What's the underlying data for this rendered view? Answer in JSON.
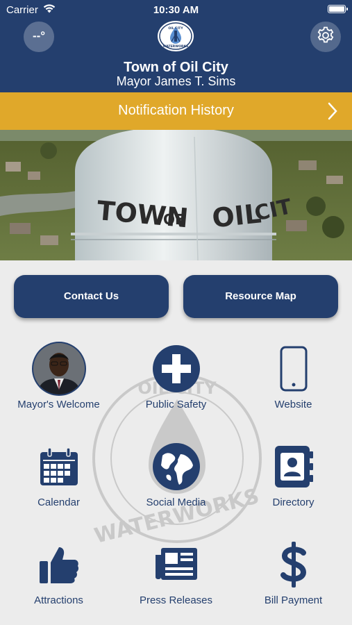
{
  "status_bar": {
    "carrier": "Carrier",
    "time": "10:30 AM"
  },
  "header": {
    "weather": "--°",
    "title": "Town of Oil City",
    "subtitle": "Mayor James T. Sims",
    "logo_text": {
      "top": "OIL CITY",
      "bottom": "WATERWORKS"
    }
  },
  "notification_bar": {
    "label": "Notification History"
  },
  "hero": {
    "tank_text": {
      "town": "TOWN",
      "of": "OF",
      "oil": "OIL",
      "city": "CIT"
    }
  },
  "buttons": {
    "contact": "Contact Us",
    "resource_map": "Resource Map"
  },
  "watermark": {
    "top": "OIL CITY",
    "bottom": "WATERWORKS"
  },
  "grid": [
    {
      "label": "Mayor's Welcome",
      "icon": "mayor-photo"
    },
    {
      "label": "Public Safety",
      "icon": "cross-icon"
    },
    {
      "label": "Website",
      "icon": "phone-icon"
    },
    {
      "label": "Calendar",
      "icon": "calendar-icon"
    },
    {
      "label": "Social Media",
      "icon": "globe-icon"
    },
    {
      "label": "Directory",
      "icon": "address-book-icon"
    },
    {
      "label": "Attractions",
      "icon": "thumbs-up-icon"
    },
    {
      "label": "Press Releases",
      "icon": "newspaper-icon"
    },
    {
      "label": "Bill Payment",
      "icon": "dollar-icon"
    }
  ],
  "colors": {
    "navy": "#243f6e",
    "gold": "#e0a82a",
    "background": "#ececec"
  }
}
